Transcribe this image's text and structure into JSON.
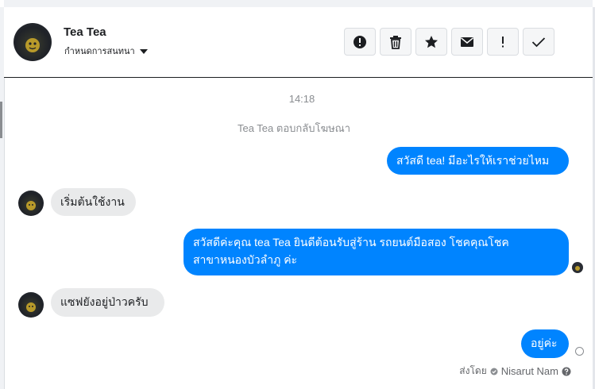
{
  "header": {
    "contact_name": "Tea Tea",
    "assign_label": "กำหนดการสนทนา"
  },
  "toolbar": {
    "buttons": [
      {
        "name": "spam",
        "icon": "alert-circle-icon"
      },
      {
        "name": "delete",
        "icon": "trash-icon"
      },
      {
        "name": "star",
        "icon": "star-icon"
      },
      {
        "name": "mark-unread",
        "icon": "envelope-icon"
      },
      {
        "name": "follow-up",
        "icon": "exclamation-icon"
      },
      {
        "name": "done",
        "icon": "check-icon"
      }
    ]
  },
  "conversation": {
    "timestamp": "14:18",
    "notice": "Tea Tea ตอบกลับโฆษณา",
    "messages": [
      {
        "from": "page",
        "text": "สวัสดี tea! มีอะไรให้เราช่วยไหม"
      },
      {
        "from": "user",
        "text": "เริ่มต้นใช้งาน"
      },
      {
        "from": "page",
        "text_line1": "สวัสดีค่ะคุณ tea Tea ยินดีต้อนรับสู่ร้าน รถยนต์มือสอง โชคคุณโชค",
        "text_line2": "สาขาหนองบัวลำภู ค่ะ"
      },
      {
        "from": "user",
        "text": "แซฟยังอยู่ป่าวครับ"
      },
      {
        "from": "page",
        "text": "อยู่ค่ะ"
      }
    ],
    "sent_by_label": "ส่งโดย",
    "sent_by_name": "Nisarut Nam"
  },
  "colors": {
    "outgoing_bubble": "#0084ff",
    "incoming_bubble": "#e9eaeb",
    "muted_text": "#8a8d91"
  }
}
